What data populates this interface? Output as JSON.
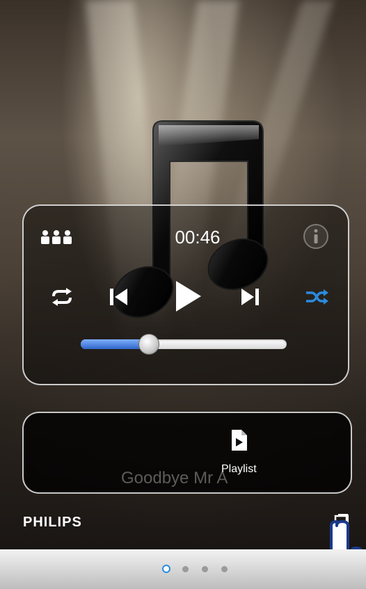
{
  "player": {
    "time": "00:46",
    "progress_fraction": 0.33,
    "icons": {
      "group": "people-group-icon",
      "info": "info-icon",
      "repeat": "repeat-icon",
      "previous": "previous-track-icon",
      "play": "play-icon",
      "next": "next-track-icon",
      "shuffle": "shuffle-icon"
    }
  },
  "playlist": {
    "song_title": "Goodbye Mr A",
    "label": "Playlist",
    "icon": "playlist-file-icon"
  },
  "brand": "PHILIPS",
  "pager": {
    "count": 4,
    "active": 0
  },
  "colors": {
    "accent": "#2b8be0",
    "shuffle": "#2b8be0"
  }
}
